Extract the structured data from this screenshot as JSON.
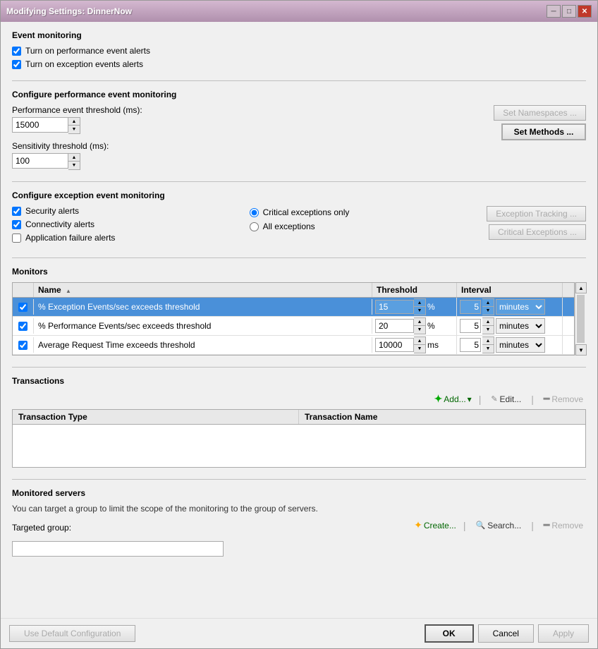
{
  "window": {
    "title": "Modifying Settings: DinnerNow"
  },
  "sections": {
    "event_monitoring": {
      "title": "Event monitoring",
      "checkbox1_label": "Turn on performance event alerts",
      "checkbox1_checked": true,
      "checkbox2_label": "Turn on exception events alerts",
      "checkbox2_checked": true
    },
    "configure_performance": {
      "title": "Configure performance event monitoring",
      "perf_threshold_label": "Performance event threshold (ms):",
      "perf_threshold_value": "15000",
      "set_namespaces_label": "Set Namespaces ...",
      "set_methods_label": "Set Methods ...",
      "sensitivity_label": "Sensitivity threshold (ms):",
      "sensitivity_value": "100"
    },
    "configure_exception": {
      "title": "Configure exception event monitoring",
      "checkbox_security_label": "Security alerts",
      "checkbox_security_checked": true,
      "checkbox_connectivity_label": "Connectivity alerts",
      "checkbox_connectivity_checked": true,
      "checkbox_appfailure_label": "Application failure alerts",
      "checkbox_appfailure_checked": false,
      "radio_critical_label": "Critical exceptions only",
      "radio_critical_checked": true,
      "radio_all_label": "All exceptions",
      "radio_all_checked": false,
      "exception_tracking_label": "Exception Tracking ...",
      "critical_exceptions_label": "Critical Exceptions ..."
    },
    "monitors": {
      "title": "Monitors",
      "columns": [
        "",
        "Name",
        "Threshold",
        "Interval",
        ""
      ],
      "rows": [
        {
          "checked": true,
          "name": "% Exception Events/sec exceeds threshold",
          "threshold_value": "15",
          "threshold_unit": "%",
          "interval_value": "5",
          "interval_unit": "minutes",
          "selected": true
        },
        {
          "checked": true,
          "name": "% Performance Events/sec exceeds threshold",
          "threshold_value": "20",
          "threshold_unit": "%",
          "interval_value": "5",
          "interval_unit": "minutes",
          "selected": false
        },
        {
          "checked": true,
          "name": "Average Request Time exceeds threshold",
          "threshold_value": "10000",
          "threshold_unit": "ms",
          "interval_value": "5",
          "interval_unit": "minutes",
          "selected": false
        }
      ]
    },
    "transactions": {
      "title": "Transactions",
      "add_label": "Add...",
      "edit_label": "Edit...",
      "remove_label": "Remove",
      "col_type": "Transaction Type",
      "col_name": "Transaction Name"
    },
    "monitored_servers": {
      "title": "Monitored servers",
      "description": "You can target a group to limit the scope of the monitoring to the group of servers.",
      "targeted_group_label": "Targeted group:",
      "create_label": "Create...",
      "search_label": "Search...",
      "remove_label": "Remove"
    }
  },
  "bottom_bar": {
    "use_default_label": "Use Default Configuration",
    "ok_label": "OK",
    "cancel_label": "Cancel",
    "apply_label": "Apply"
  }
}
